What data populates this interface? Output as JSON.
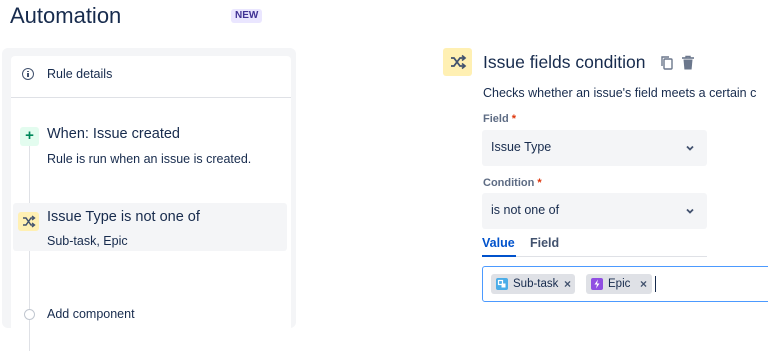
{
  "header": {
    "title": "Automation",
    "badge": "NEW"
  },
  "rule_panel": {
    "details_label": "Rule details",
    "trigger": {
      "title": "When: Issue created",
      "description": "Rule is run when an issue is created.",
      "icon": "plus-icon"
    },
    "condition": {
      "title": "Issue Type is not one of",
      "description": "Sub-task, Epic",
      "icon": "shuffle-icon"
    },
    "add_label": "Add component"
  },
  "detail": {
    "title": "Issue fields condition",
    "description": "Checks whether an issue's field meets a certain c",
    "field": {
      "label": "Field",
      "required_mark": "*",
      "value": "Issue Type"
    },
    "condition": {
      "label": "Condition",
      "required_mark": "*",
      "value": "is not one of"
    },
    "tabs": [
      {
        "label": "Value",
        "active": true
      },
      {
        "label": "Field",
        "active": false
      }
    ],
    "chips": [
      {
        "label": "Sub-task",
        "remove": "×",
        "icon_color": "#4BADE8"
      },
      {
        "label": "Epic",
        "remove": "×",
        "icon_color": "#904EE2"
      }
    ]
  },
  "colors": {
    "accent": "#0052CC",
    "focus_border": "#4C9AFF",
    "condition_icon_bg": "#FFF0B3",
    "trigger_icon_bg": "#E3FCEF"
  }
}
